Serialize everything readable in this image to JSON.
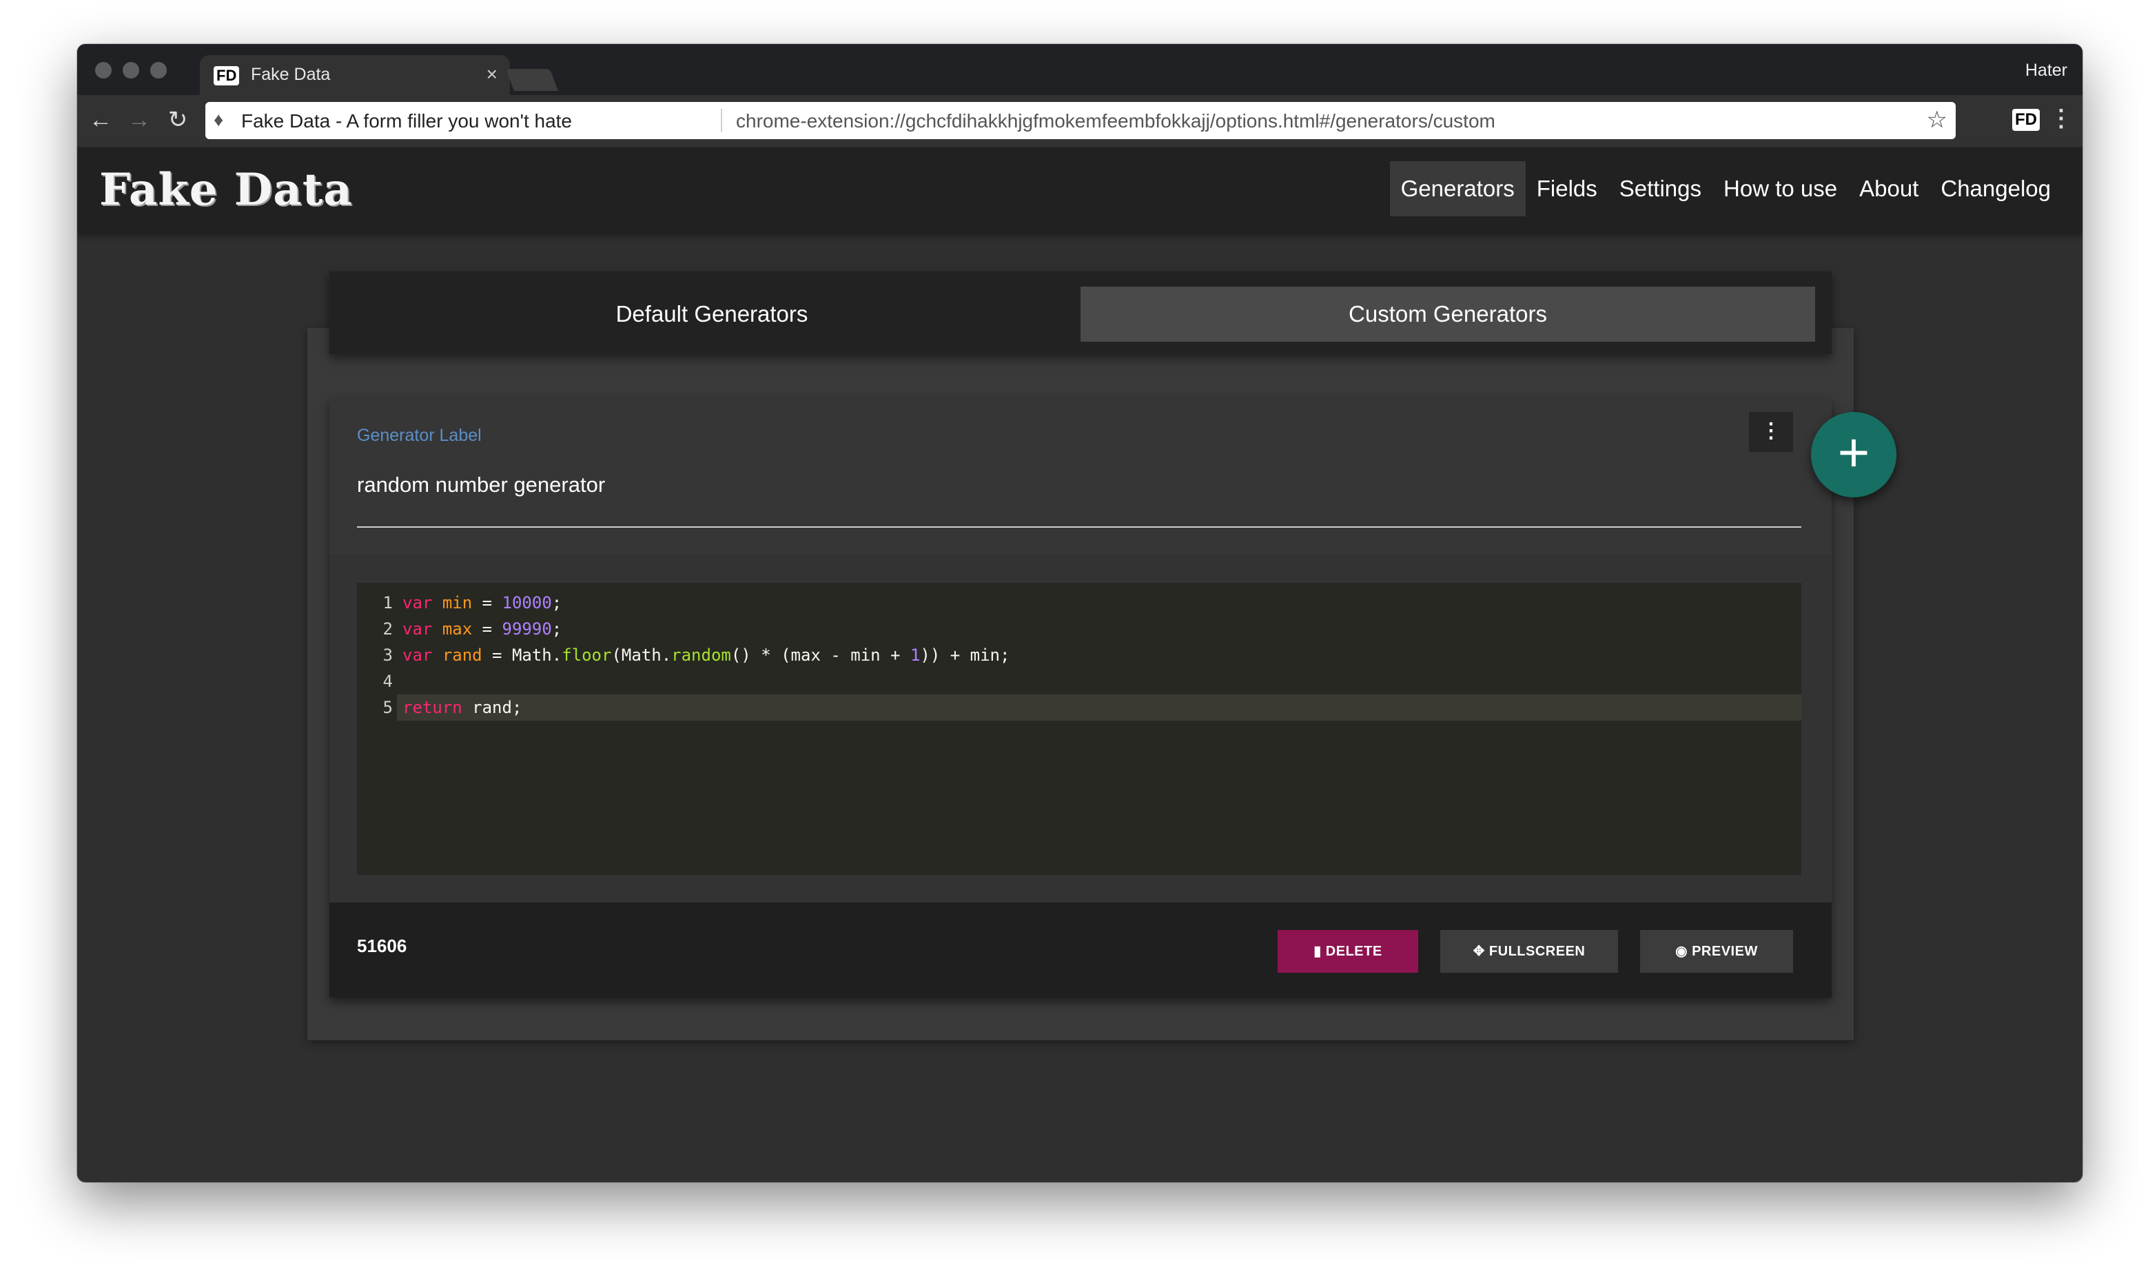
{
  "browser": {
    "tab": {
      "favicon": "FD",
      "title": "Fake Data",
      "close": "×"
    },
    "profile": "Hater",
    "omnibox": {
      "page_title": "Fake Data - A form filler you won't hate",
      "url": "chrome-extension://gchcfdihakkhjgfmokemfeembfokkajj/options.html#/generators/custom"
    },
    "extension_badge": "FD",
    "icons": [
      "back-arrow-icon",
      "forward-arrow-icon",
      "reload-icon",
      "puzzle-extension-icon",
      "star-bookmark-icon",
      "menu-dots-icon"
    ]
  },
  "app": {
    "logo": "Fake Data",
    "nav": [
      {
        "label": "Generators",
        "active": true
      },
      {
        "label": "Fields",
        "active": false
      },
      {
        "label": "Settings",
        "active": false
      },
      {
        "label": "How to use",
        "active": false
      },
      {
        "label": "About",
        "active": false
      },
      {
        "label": "Changelog",
        "active": false
      }
    ]
  },
  "generator_tabs": [
    {
      "label": "Default Generators",
      "active": false
    },
    {
      "label": "Custom Generators",
      "active": true
    }
  ],
  "generator": {
    "label_caption": "Generator Label",
    "label_value": "random number generator",
    "code_lines": [
      "var min = 10000;",
      "var max = 99990;",
      "var rand = Math.floor(Math.random() * (max - min + 1)) + min;",
      "",
      "return rand;"
    ],
    "preview_value": "51606",
    "buttons": {
      "delete": "DELETE",
      "fullscreen": "FULLSCREEN",
      "preview": "PREVIEW"
    }
  },
  "colors": {
    "accent_teal": "#166f62",
    "delete": "#8e1350",
    "label_blue": "#5b8fc7",
    "editor_bg": "#272822"
  }
}
